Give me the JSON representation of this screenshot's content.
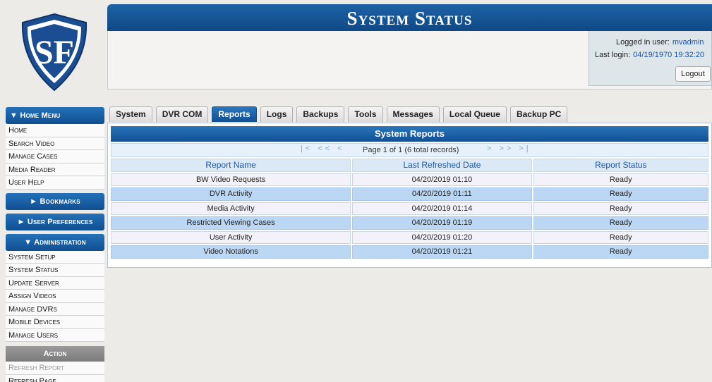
{
  "header": {
    "title": "System Status"
  },
  "login": {
    "user_label": "Logged in user:",
    "user_value": "mvadmin",
    "last_label": "Last login:",
    "last_value": "04/19/1970 19:32:20",
    "logout_label": "Logout"
  },
  "sidebar": {
    "home_menu": "▼ Home Menu",
    "home_items": [
      "Home",
      "Search Video",
      "Manage Cases",
      "Media Reader",
      "User Help"
    ],
    "bookmarks": "► Bookmarks",
    "user_prefs": "► User Preferences",
    "administration": "▼ Administration",
    "admin_items": [
      "System Setup",
      "System Status",
      "Update Server",
      "Assign Videos",
      "Manage DVRs",
      "Mobile Devices",
      "Manage Users"
    ],
    "action": "Action",
    "action_items": [
      "Refresh Report",
      "Refresh Page"
    ]
  },
  "tabs": [
    "System",
    "DVR COM",
    "Reports",
    "Logs",
    "Backups",
    "Tools",
    "Messages",
    "Local Queue",
    "Backup PC"
  ],
  "active_tab": "Reports",
  "table": {
    "title": "System Reports",
    "pager_left": "|< << <",
    "pager_info": "Page 1 of 1 (6 total records)",
    "pager_right": "> >> >|",
    "columns": [
      "Report Name",
      "Last Refreshed Date",
      "Report Status"
    ],
    "rows": [
      [
        "BW Video Requests",
        "04/20/2019 01:10",
        "Ready"
      ],
      [
        "DVR Activity",
        "04/20/2019 01:11",
        "Ready"
      ],
      [
        "Media Activity",
        "04/20/2019 01:14",
        "Ready"
      ],
      [
        "Restricted Viewing Cases",
        "04/20/2019 01:19",
        "Ready"
      ],
      [
        "User Activity",
        "04/20/2019 01:20",
        "Ready"
      ],
      [
        "Video Notations",
        "04/20/2019 01:21",
        "Ready"
      ]
    ]
  },
  "colors": {
    "accent": "#114f92",
    "row_alt": "#bcd7f3"
  },
  "icons": {
    "logo": "sf-shield-logo"
  }
}
